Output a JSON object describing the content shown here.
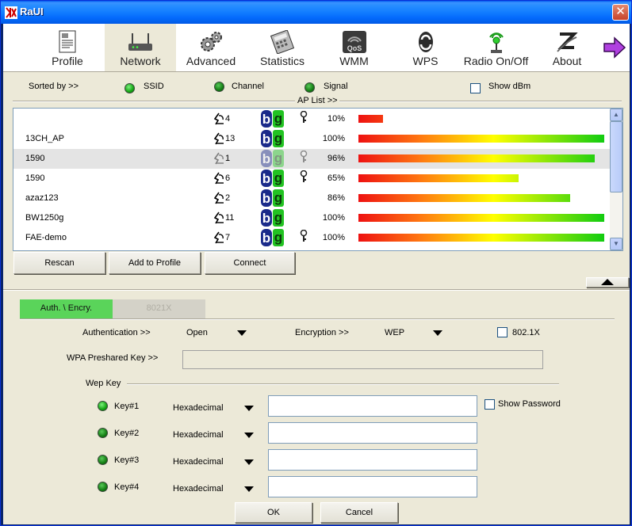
{
  "window": {
    "title": "RaUI",
    "close_glyph": "✕"
  },
  "toolbar": {
    "items": [
      {
        "label": "Profile",
        "icon": "profile-icon"
      },
      {
        "label": "Network",
        "icon": "network-icon"
      },
      {
        "label": "Advanced",
        "icon": "advanced-icon"
      },
      {
        "label": "Statistics",
        "icon": "statistics-icon"
      },
      {
        "label": "WMM",
        "icon": "wmm-icon",
        "icon_text": "QoS"
      },
      {
        "label": "WPS",
        "icon": "wps-icon"
      },
      {
        "label": "Radio On/Off",
        "icon": "radio-icon"
      },
      {
        "label": "About",
        "icon": "about-icon"
      }
    ],
    "next_icon": "arrow-right-icon"
  },
  "sort": {
    "label": "Sorted by >>",
    "ssid": "SSID",
    "channel": "Channel",
    "signal": "Signal",
    "show_dbm": "Show dBm"
  },
  "ap_list": {
    "label": "AP List >>",
    "rows": [
      {
        "ssid": "",
        "channel": "4",
        "mode_b": "b",
        "mode_g": "g",
        "secured": true,
        "signal": 10,
        "signal_text": "10%"
      },
      {
        "ssid": "13CH_AP",
        "channel": "13",
        "mode_b": "b",
        "mode_g": "g",
        "secured": false,
        "signal": 100,
        "signal_text": "100%"
      },
      {
        "ssid": "1590",
        "channel": "1",
        "mode_b": "b",
        "mode_g": "g",
        "secured": true,
        "signal": 96,
        "signal_text": "96%",
        "selected": true
      },
      {
        "ssid": "1590",
        "channel": "6",
        "mode_b": "b",
        "mode_g": "g",
        "secured": true,
        "signal": 65,
        "signal_text": "65%"
      },
      {
        "ssid": "azaz123",
        "channel": "2",
        "mode_b": "b",
        "mode_g": "g",
        "secured": false,
        "signal": 86,
        "signal_text": "86%"
      },
      {
        "ssid": "BW1250g",
        "channel": "11",
        "mode_b": "b",
        "mode_g": "g",
        "secured": false,
        "signal": 100,
        "signal_text": "100%"
      },
      {
        "ssid": "FAE-demo",
        "channel": "7",
        "mode_b": "b",
        "mode_g": "g",
        "secured": true,
        "signal": 100,
        "signal_text": "100%"
      }
    ]
  },
  "buttons": {
    "rescan": "Rescan",
    "add_to_profile": "Add to Profile",
    "connect": "Connect",
    "ok": "OK",
    "cancel": "Cancel"
  },
  "tabs": {
    "auth": "Auth. \\ Encry.",
    "dot1x": "8021X"
  },
  "auth": {
    "authentication_label": "Authentication >>",
    "authentication_value": "Open",
    "encryption_label": "Encryption >>",
    "encryption_value": "WEP",
    "dot1x_label": "802.1X",
    "wpa_label": "WPA Preshared Key >>",
    "wep_key_label": "Wep Key",
    "show_password": "Show Password",
    "keys": [
      {
        "label": "Key#1",
        "format": "Hexadecimal",
        "value": ""
      },
      {
        "label": "Key#2",
        "format": "Hexadecimal",
        "value": ""
      },
      {
        "label": "Key#3",
        "format": "Hexadecimal",
        "value": ""
      },
      {
        "label": "Key#4",
        "format": "Hexadecimal",
        "value": ""
      }
    ]
  },
  "colors": {
    "selected_tab": "#5ad45a",
    "title_blue": "#0369fc"
  }
}
